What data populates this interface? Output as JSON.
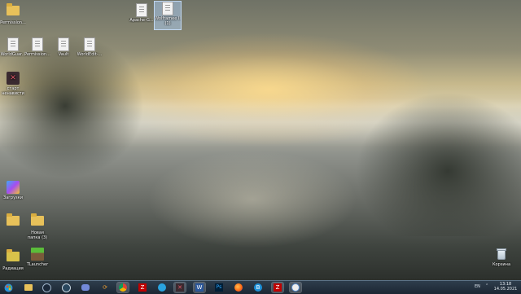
{
  "desktop": {
    "icons": [
      {
        "label": "Permission...",
        "kind": "folder"
      },
      {
        "label": "WorldGuar...",
        "kind": "doc"
      },
      {
        "label": "Permission...",
        "kind": "doc"
      },
      {
        "label": "Vault",
        "kind": "doc"
      },
      {
        "label": "WorldEdit-...",
        "kind": "doc"
      },
      {
        "label": "Apache-G...",
        "kind": "doc"
      },
      {
        "label": "Wolframee Il (1)",
        "kind": "doc"
      },
      {
        "label": "старт ненависти",
        "kind": "app"
      },
      {
        "label": "Загрузки",
        "kind": "app"
      },
      {
        "label": "",
        "kind": "folder"
      },
      {
        "label": "Новая папка (3)",
        "kind": "folder"
      },
      {
        "label": "Радиация",
        "kind": "folder"
      },
      {
        "label": "TLauncher",
        "kind": "app"
      },
      {
        "label": "Корзина",
        "kind": "recycle"
      }
    ]
  },
  "taskbar": {
    "language": "EN",
    "time": "13:18",
    "date": "14.05.2021",
    "apps": [
      "start",
      "explorer",
      "steam",
      "steam2",
      "discord",
      "chrome-arrows",
      "chrome",
      "filezilla",
      "telegram",
      "wolfram",
      "word",
      "photoshop",
      "firefox",
      "browser-b",
      "filezilla2",
      "settings"
    ]
  }
}
